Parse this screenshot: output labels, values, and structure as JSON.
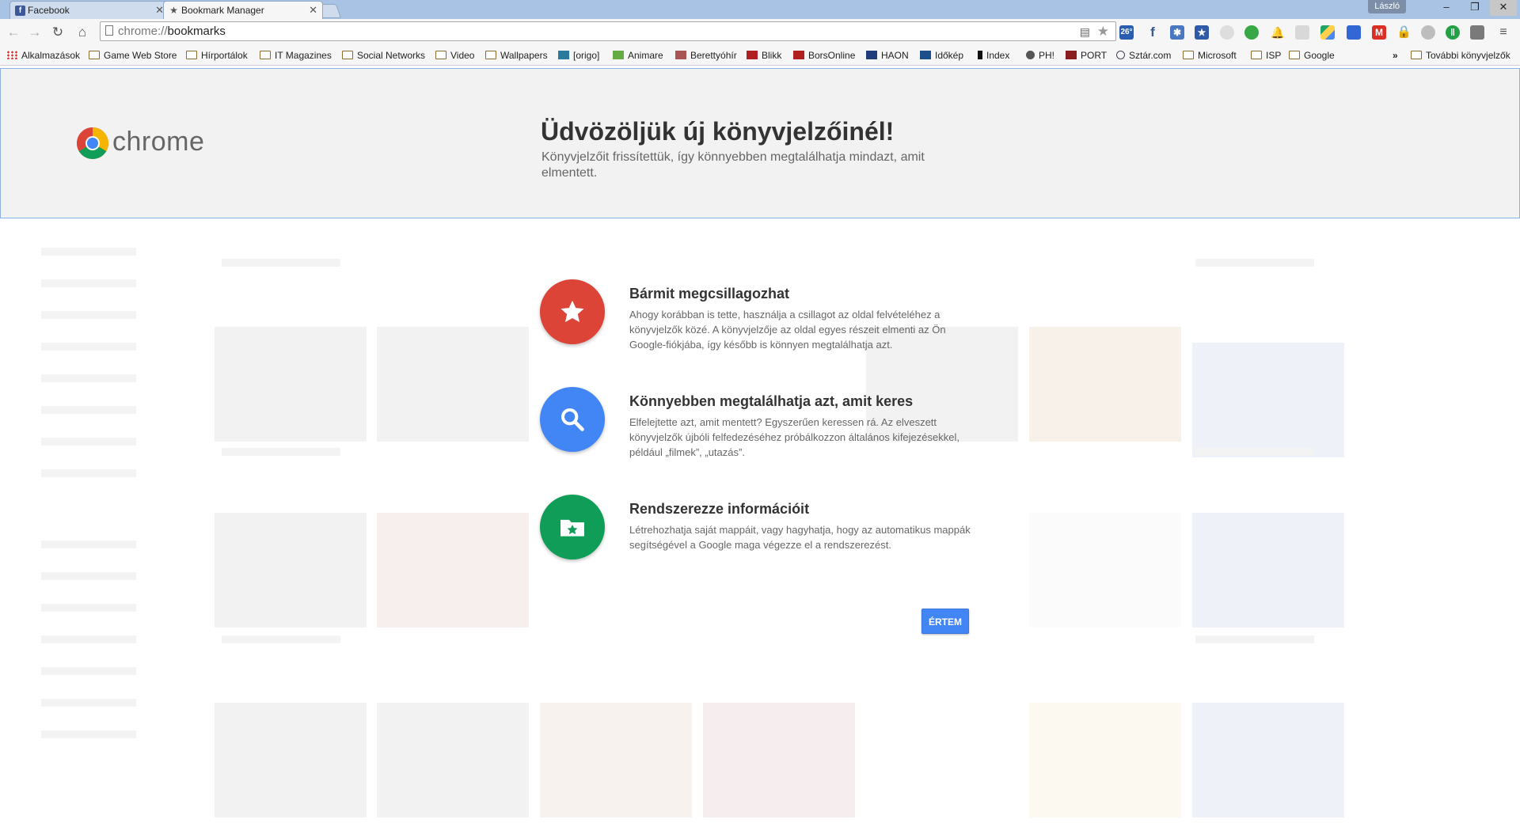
{
  "tabs": [
    {
      "label": "Facebook",
      "icon": "facebook-icon"
    },
    {
      "label": "Bookmark Manager",
      "icon": "star-icon"
    }
  ],
  "window": {
    "user": "László"
  },
  "toolbar": {
    "url_scheme": "chrome://",
    "url_path": "bookmarks",
    "weather_badge": "26°"
  },
  "bookmarks_bar": {
    "items": [
      {
        "label": "Alkalmazások",
        "type": "apps"
      },
      {
        "label": "Game Web Store",
        "type": "folder"
      },
      {
        "label": "Hírportálok",
        "type": "folder"
      },
      {
        "label": "IT Magazines",
        "type": "folder"
      },
      {
        "label": "Social Networks",
        "type": "folder"
      },
      {
        "label": "Video",
        "type": "folder"
      },
      {
        "label": "Wallpapers",
        "type": "folder"
      },
      {
        "label": "[origo]",
        "type": "site"
      },
      {
        "label": "Animare",
        "type": "site"
      },
      {
        "label": "Berettyóhír",
        "type": "site"
      },
      {
        "label": "Blikk",
        "type": "site"
      },
      {
        "label": "BorsOnline",
        "type": "site"
      },
      {
        "label": "HAON",
        "type": "site"
      },
      {
        "label": "Időkép",
        "type": "site"
      },
      {
        "label": "Index",
        "type": "site"
      },
      {
        "label": "PH!",
        "type": "site"
      },
      {
        "label": "PORT",
        "type": "site"
      },
      {
        "label": "Sztár.com",
        "type": "site"
      },
      {
        "label": "Microsoft",
        "type": "folder"
      },
      {
        "label": "ISP",
        "type": "folder"
      },
      {
        "label": "Google",
        "type": "folder"
      }
    ],
    "overflow": "»",
    "other": "További könyvjelzők"
  },
  "welcome": {
    "brand": "chrome",
    "title": "Üdvözöljük új könyvjelzőinél!",
    "subtitle": "Könyvjelzőit frissítettük, így könnyebben megtalálhatja mindazt, amit elmentett.",
    "features": [
      {
        "title": "Bármit megcsillagozhat",
        "desc": "Ahogy korábban is tette, használja a csillagot az oldal felvételéhez a könyvjelzők közé. A könyvjelzője az oldal egyes részeit elmenti az Ön Google-fiókjába, így később is könnyen megtalálhatja azt.",
        "color": "#db4437",
        "icon": "star-icon"
      },
      {
        "title": "Könnyebben megtalálhatja azt, amit keres",
        "desc": "Elfelejtette azt, amit mentett? Egyszerűen keressen rá. Az elveszett könyvjelzők újbóli felfedezéséhez próbálkozzon általános kifejezésekkel, például „filmek”, „utazás”.",
        "color": "#4285f4",
        "icon": "search-icon"
      },
      {
        "title": "Rendszerezze információit",
        "desc": "Létrehozhatja saját mappáit, vagy hagyhatja, hogy az automatikus mappák segítségével a Google maga végezze el a rendszerezést.",
        "color": "#0f9d58",
        "icon": "folder-star-icon"
      }
    ],
    "ok_label": "ÉRTEM"
  }
}
